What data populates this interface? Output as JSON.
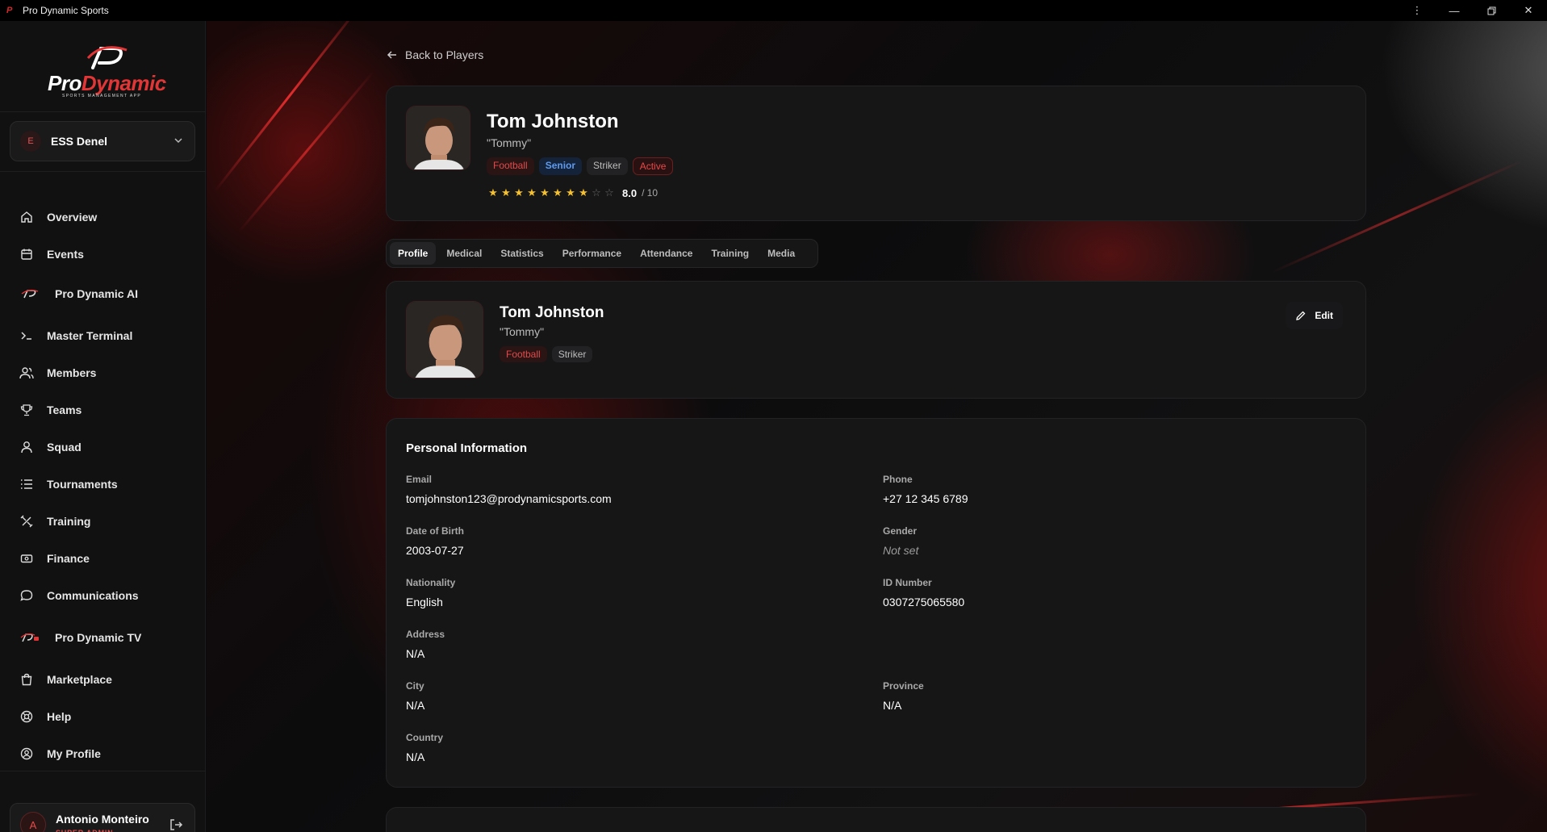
{
  "window": {
    "title": "Pro Dynamic Sports"
  },
  "brand": {
    "word_a": "Pro",
    "word_b": "Dynamic",
    "tagline": "SPORTS MANAGEMENT APP"
  },
  "org": {
    "initial": "E",
    "name": "ESS Denel"
  },
  "nav": [
    {
      "label": "Overview",
      "icon": "home-icon"
    },
    {
      "label": "Events",
      "icon": "calendar-icon"
    },
    {
      "label": "Pro Dynamic AI",
      "icon": "pd-logo-icon"
    },
    {
      "label": "Master Terminal",
      "icon": "terminal-icon"
    },
    {
      "label": "Members",
      "icon": "members-icon"
    },
    {
      "label": "Teams",
      "icon": "trophy-icon"
    },
    {
      "label": "Squad",
      "icon": "user-icon"
    },
    {
      "label": "Tournaments",
      "icon": "list-icon"
    },
    {
      "label": "Training",
      "icon": "training-icon"
    },
    {
      "label": "Finance",
      "icon": "finance-icon"
    },
    {
      "label": "Communications",
      "icon": "chat-icon"
    },
    {
      "label": "Pro Dynamic TV",
      "icon": "pd-tv-icon"
    },
    {
      "label": "Marketplace",
      "icon": "shopping-bag-icon"
    },
    {
      "label": "Help",
      "icon": "help-icon"
    },
    {
      "label": "My Profile",
      "icon": "profile-icon"
    }
  ],
  "user": {
    "initial": "A",
    "name": "Antonio Monteiro",
    "role": "SUPER ADMIN"
  },
  "back_label": "Back to Players",
  "player": {
    "name": "Tom Johnston",
    "nickname": "\"Tommy\"",
    "badges": [
      "Football",
      "Senior",
      "Striker",
      "Active"
    ],
    "rating": 8.0,
    "rating_text": "8.0",
    "rating_max": "/ 10",
    "stars_total": 10,
    "stars_filled": 8
  },
  "tabs": [
    "Profile",
    "Medical",
    "Statistics",
    "Performance",
    "Attendance",
    "Training",
    "Media"
  ],
  "active_tab": "Profile",
  "profile_card": {
    "name": "Tom Johnston",
    "nickname": "\"Tommy\"",
    "badges": [
      "Football",
      "Striker"
    ],
    "edit_label": "Edit"
  },
  "personal": {
    "title": "Personal Information",
    "email_label": "Email",
    "email": "tomjohnston123@prodynamicsports.com",
    "phone_label": "Phone",
    "phone": "+27 12 345 6789",
    "dob_label": "Date of Birth",
    "dob": "2003-07-27",
    "gender_label": "Gender",
    "gender": "Not set",
    "nationality_label": "Nationality",
    "nationality": "English",
    "id_label": "ID Number",
    "id_number": "0307275065580",
    "address_label": "Address",
    "address": "N/A",
    "city_label": "City",
    "city": "N/A",
    "province_label": "Province",
    "province": "N/A",
    "country_label": "Country",
    "country": "N/A"
  },
  "colors": {
    "accent": "#e23636",
    "star": "#f5c02a",
    "senior_badge": "#5d9bf0"
  }
}
